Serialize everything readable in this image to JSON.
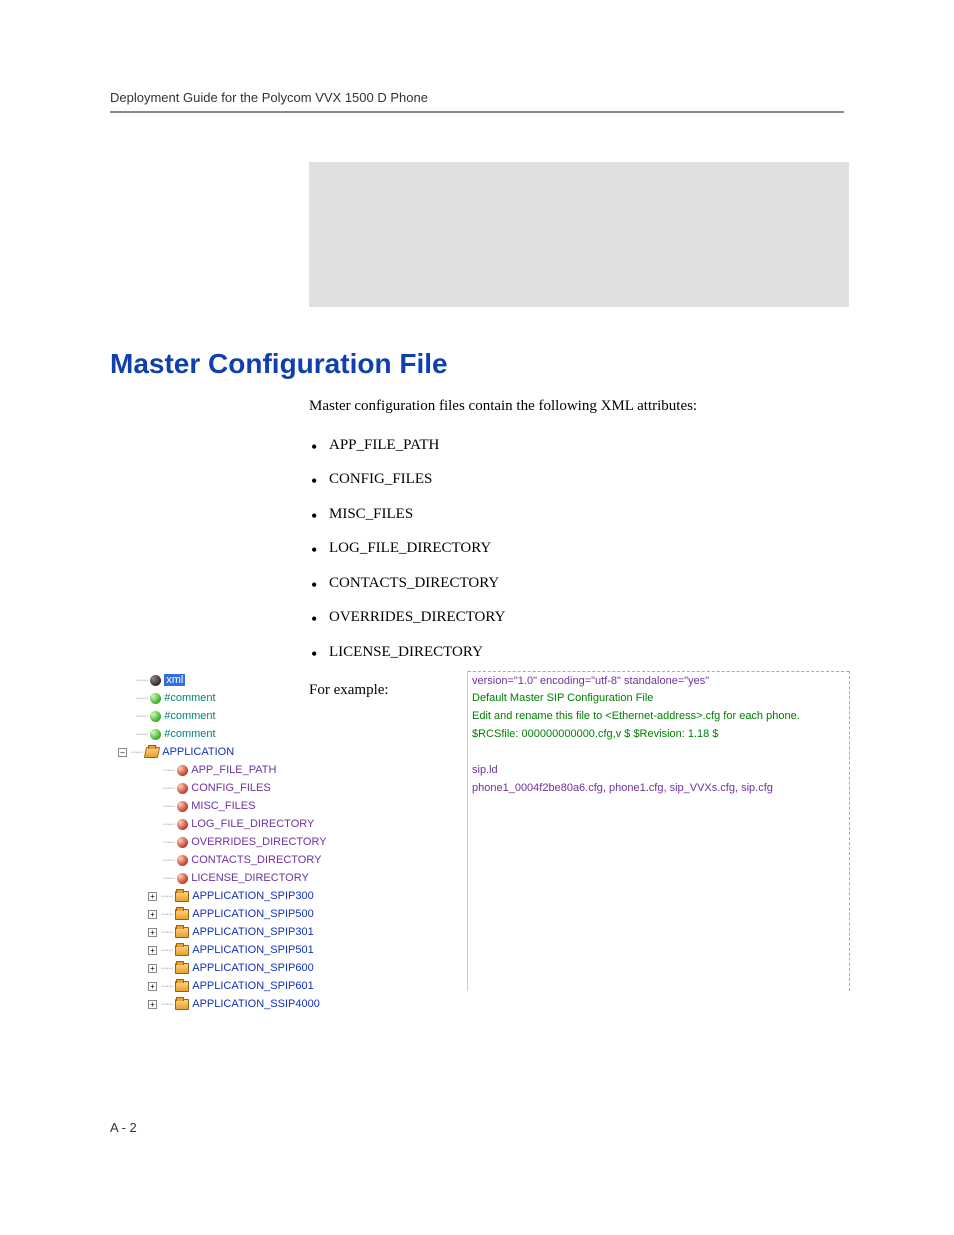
{
  "header": {
    "title": "Deployment Guide for the Polycom VVX 1500 D Phone"
  },
  "heading": "Master Configuration File",
  "intro": "Master configuration files contain the following XML attributes:",
  "attributes": [
    "APP_FILE_PATH",
    "CONFIG_FILES",
    "MISC_FILES",
    "LOG_FILE_DIRECTORY",
    "CONTACTS_DIRECTORY",
    "OVERRIDES_DIRECTORY",
    "LICENSE_DIRECTORY"
  ],
  "for_example": "For example:",
  "tree": {
    "root": "xml",
    "comments": [
      "#comment",
      "#comment",
      "#comment"
    ],
    "application": "APPLICATION",
    "app_children": [
      "APP_FILE_PATH",
      "CONFIG_FILES",
      "MISC_FILES",
      "LOG_FILE_DIRECTORY",
      "OVERRIDES_DIRECTORY",
      "CONTACTS_DIRECTORY",
      "LICENSE_DIRECTORY"
    ],
    "app_folders": [
      "APPLICATION_SPIP300",
      "APPLICATION_SPIP500",
      "APPLICATION_SPIP301",
      "APPLICATION_SPIP501",
      "APPLICATION_SPIP600",
      "APPLICATION_SPIP601",
      "APPLICATION_SSIP4000"
    ]
  },
  "values": {
    "xml_decl": "version=\"1.0\" encoding=\"utf-8\" standalone=\"yes\"",
    "comment1": "Default Master SIP Configuration File",
    "comment2": "Edit and rename this file to <Ethernet-address>.cfg for each phone.",
    "comment3": "$RCSfile: 000000000000.cfg,v $  $Revision: 1.18 $",
    "app_file_path": "sip.ld",
    "config_files": "phone1_0004f2be80a6.cfg, phone1.cfg, sip_VVXs.cfg, sip.cfg"
  },
  "page_number": "A - 2"
}
